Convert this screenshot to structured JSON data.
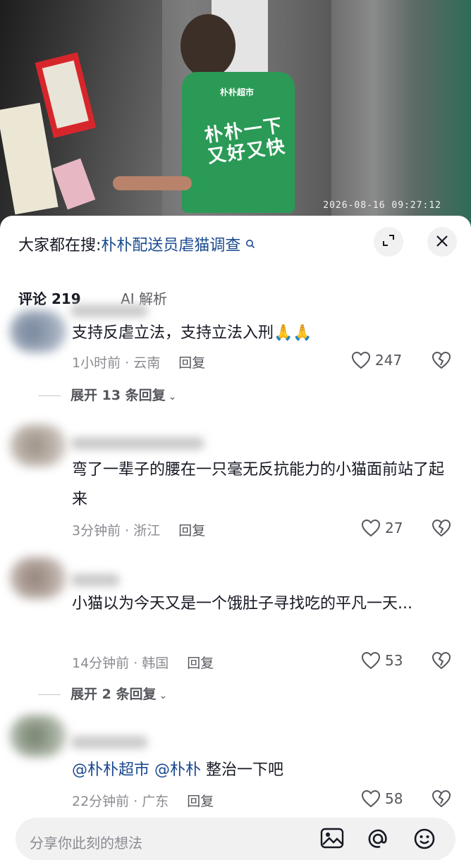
{
  "video": {
    "vest_logo": "朴朴超市",
    "vest_slogan": "朴朴一下又好又快",
    "timestamp": "2026-08-16 09:27:12"
  },
  "search_bar": {
    "prefix": "大家都在搜:",
    "term": "朴朴配送员虐猫调查",
    "icon": "search-icon"
  },
  "header_buttons": {
    "expand_icon": "expand-icon",
    "close_icon": "close-icon"
  },
  "tabs": [
    {
      "label": "评论 219",
      "active": true
    },
    {
      "label": "AI 解析",
      "active": false
    }
  ],
  "comments": [
    {
      "text": "支持反虐立法，支持立法入刑🙏🙏",
      "time_location": "1小时前 · 云南",
      "reply_label": "回复",
      "likes": "247",
      "expand_label": "展开 13 条回复"
    },
    {
      "text": "弯了一辈子的腰在一只毫无反抗能力的小猫面前站了起来",
      "time_location": "3分钟前 · 浙江",
      "reply_label": "回复",
      "likes": "27"
    },
    {
      "text": "小猫以为今天又是一个饿肚子寻找吃的平凡一天...",
      "time_location": "14分钟前 · 韩国",
      "reply_label": "回复",
      "likes": "53",
      "expand_label": "展开 2 条回复"
    },
    {
      "mention1": "@朴朴超市",
      "mention2": "@朴朴",
      "text": "整治一下吧",
      "time_location": "22分钟前 · 广东",
      "reply_label": "回复",
      "likes": "58"
    }
  ],
  "input": {
    "placeholder": "分享你此刻的想法",
    "icons": [
      "image-icon",
      "at-icon",
      "emoji-icon"
    ]
  },
  "colors": {
    "link_blue": "#1a4a8f",
    "text_primary": "#161823",
    "text_secondary": "#8a8b91",
    "vest_green": "#2a9a56"
  }
}
